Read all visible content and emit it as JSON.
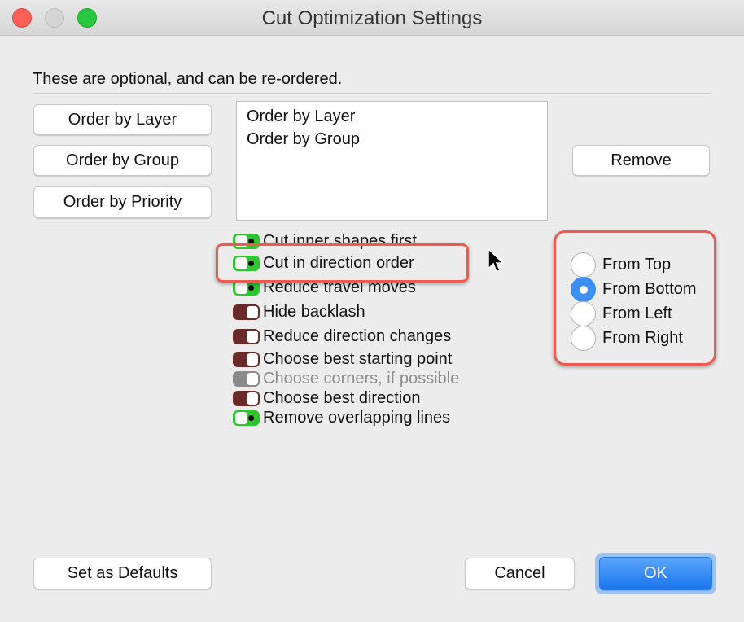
{
  "window": {
    "title": "Cut Optimization Settings"
  },
  "colors": {
    "close": "#fd5f57",
    "minimize": "#d4d4d4",
    "zoom": "#28c940",
    "toggle_on": "#2ec52e",
    "toggle_off": "#6b2a2a",
    "accent": "#3d8ff3",
    "highlight": "#f0594e"
  },
  "instructions": "These are optional, and can be re-ordered.",
  "order_buttons": [
    "Order by Layer",
    "Order by Group",
    "Order by Priority"
  ],
  "order_list": [
    "Order by Layer",
    "Order by Group"
  ],
  "remove_label": "Remove",
  "options": [
    {
      "label": "Cut inner shapes first",
      "state": "on"
    },
    {
      "label": "Cut in direction order",
      "state": "on"
    },
    {
      "label": "Reduce travel moves",
      "state": "on"
    },
    {
      "label": "Hide backlash",
      "state": "off"
    },
    {
      "label": "Reduce direction changes",
      "state": "off"
    },
    {
      "label": "Choose best starting point",
      "state": "off"
    },
    {
      "label": "Choose corners, if possible",
      "state": "disabled"
    },
    {
      "label": "Choose best direction",
      "state": "off"
    },
    {
      "label": "Remove overlapping lines",
      "state": "on"
    }
  ],
  "direction": {
    "options": [
      "From Top",
      "From Bottom",
      "From Left",
      "From Right"
    ],
    "selected": "From Bottom"
  },
  "footer": {
    "defaults": "Set as Defaults",
    "cancel": "Cancel",
    "ok": "OK"
  }
}
